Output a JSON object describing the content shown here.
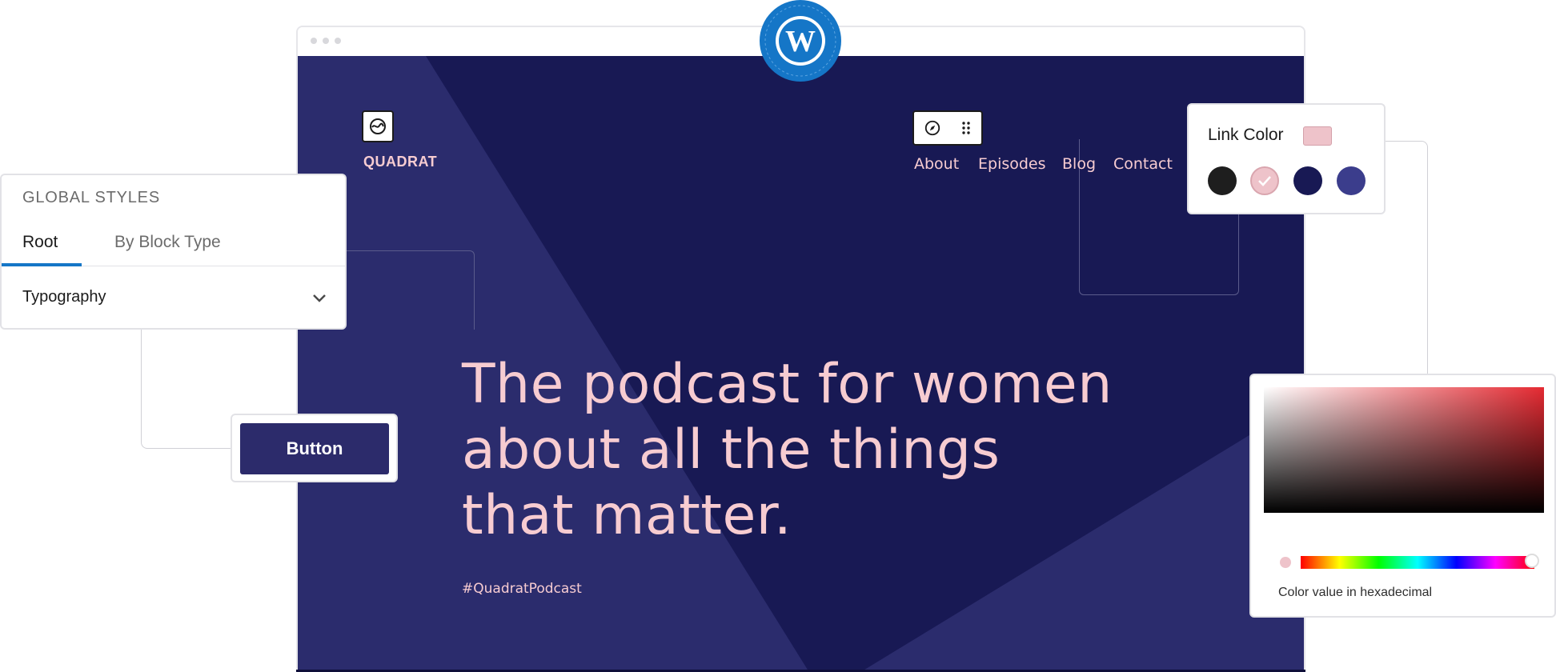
{
  "browser": {
    "dots": [
      "",
      "",
      ""
    ]
  },
  "site": {
    "title": "QUADRAT",
    "nav": [
      "About",
      "Episodes",
      "Blog",
      "Contact"
    ],
    "hero_lines": [
      "The podcast for women",
      "about all the things",
      "that matter."
    ],
    "hashtag": "#QuadratPodcast"
  },
  "global_styles": {
    "title": "GLOBAL STYLES",
    "tabs": [
      "Root",
      "By Block Type"
    ],
    "active_tab": "Root",
    "section": "Typography"
  },
  "button_sample": {
    "label": "Button"
  },
  "link_color": {
    "label": "Link Color",
    "current": "#eec3ca",
    "options": [
      "#1e1e1e",
      "#eec3ca",
      "#181954",
      "#3b3d8c"
    ],
    "selected_index": 1
  },
  "color_picker": {
    "hue_fraction": 0.99,
    "label": "Color value in hexadecimal"
  },
  "colors": {
    "site_bg": "#181954",
    "site_accent": "#f7ccd1",
    "wp_blue": "#1576c7",
    "tab_active": "#1576c7"
  },
  "icons": [
    "wordpress-logo-icon",
    "site-logo-icon",
    "compass-icon",
    "drag-handle-icon",
    "chevron-down-icon",
    "check-icon"
  ]
}
